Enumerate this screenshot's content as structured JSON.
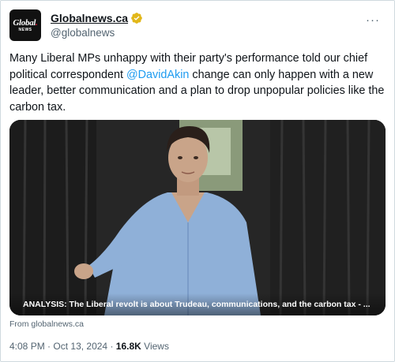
{
  "account": {
    "display_name": "Globalnews.ca",
    "handle": "@globalnews",
    "avatar_line1": "Global",
    "avatar_line2": "NEWS",
    "verified_color": "#e2b719"
  },
  "more_glyph": "···",
  "tweet": {
    "text_before": "Many Liberal MPs unhappy with their party's performance told our chief political correspondent ",
    "mention": "@DavidAkin",
    "text_after": " change can only happen with a new leader, better communication and a plan to drop unpopular policies like the carbon tax."
  },
  "card": {
    "caption": "ANALYSIS: The Liberal revolt is about Trudeau, communications, and the carbon tax - ...",
    "source": "From globalnews.ca"
  },
  "meta": {
    "time": "4:08 PM",
    "date": "Oct 13, 2024",
    "separator": "·",
    "views_count": "16.8K",
    "views_label": "Views"
  },
  "colors": {
    "accent": "#1d9bf0",
    "secondary_text": "#536471",
    "primary_text": "#0f1419"
  }
}
